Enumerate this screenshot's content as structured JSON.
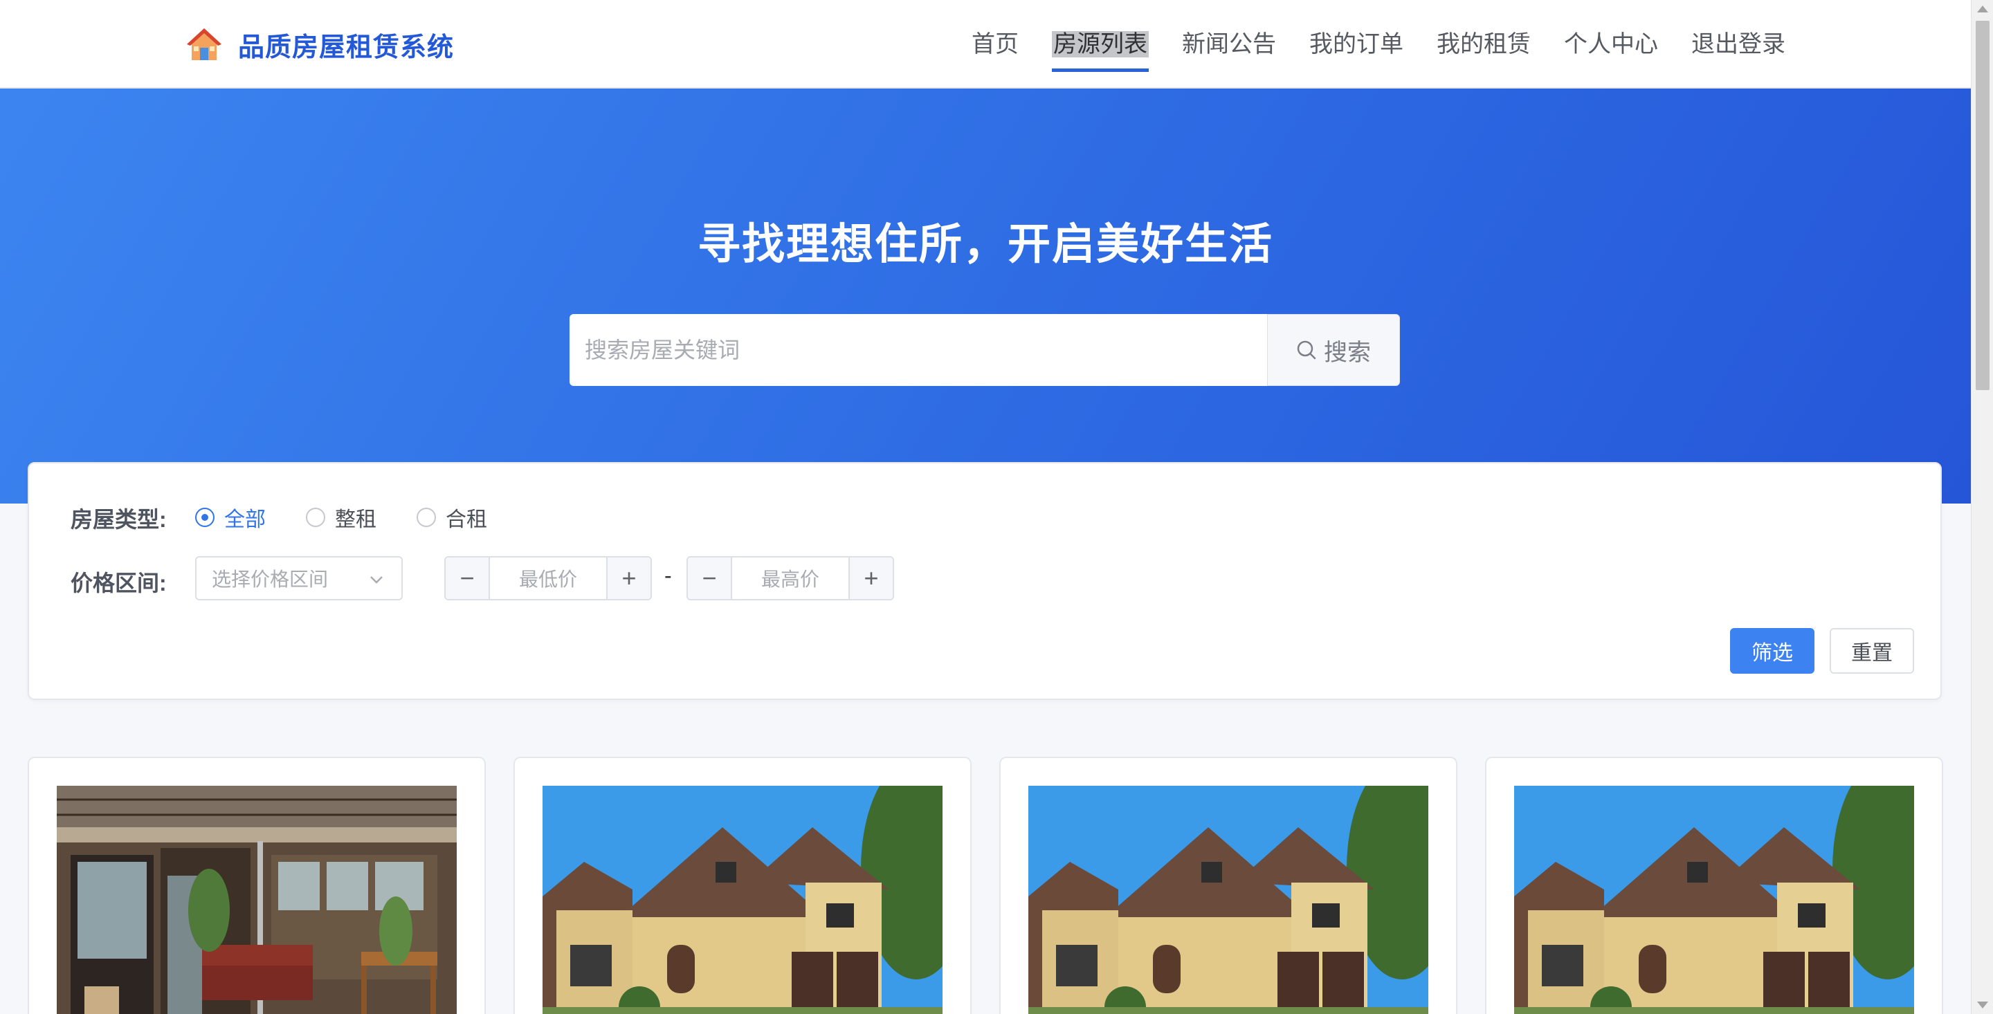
{
  "app": {
    "title": "品质房屋租赁系统"
  },
  "nav": {
    "items": [
      {
        "label": "首页"
      },
      {
        "label": "房源列表",
        "active": true
      },
      {
        "label": "新闻公告"
      },
      {
        "label": "我的订单"
      },
      {
        "label": "我的租赁"
      },
      {
        "label": "个人中心"
      },
      {
        "label": "退出登录"
      }
    ]
  },
  "hero": {
    "title": "寻找理想住所，开启美好生活",
    "search_placeholder": "搜索房屋关键词",
    "search_button": "搜索"
  },
  "filter": {
    "type_label": "房屋类型:",
    "type_options": [
      {
        "label": "全部",
        "checked": true
      },
      {
        "label": "整租",
        "checked": false
      },
      {
        "label": "合租",
        "checked": false
      }
    ],
    "price_label": "价格区间:",
    "price_select_placeholder": "选择价格区间",
    "min_price_placeholder": "最低价",
    "max_price_placeholder": "最高价",
    "range_separator": "-",
    "minus_symbol": "−",
    "plus_symbol": "+",
    "filter_button": "筛选",
    "reset_button": "重置"
  },
  "houses": [
    {
      "image": "courtyard-interior-photo"
    },
    {
      "image": "yellow-house-photo"
    },
    {
      "image": "yellow-house-photo"
    },
    {
      "image": "yellow-house-photo"
    }
  ],
  "colors": {
    "brand": "#2359d6",
    "primary": "#3c82f0",
    "hero_start": "#3c85f0",
    "hero_end": "#2556d8"
  }
}
